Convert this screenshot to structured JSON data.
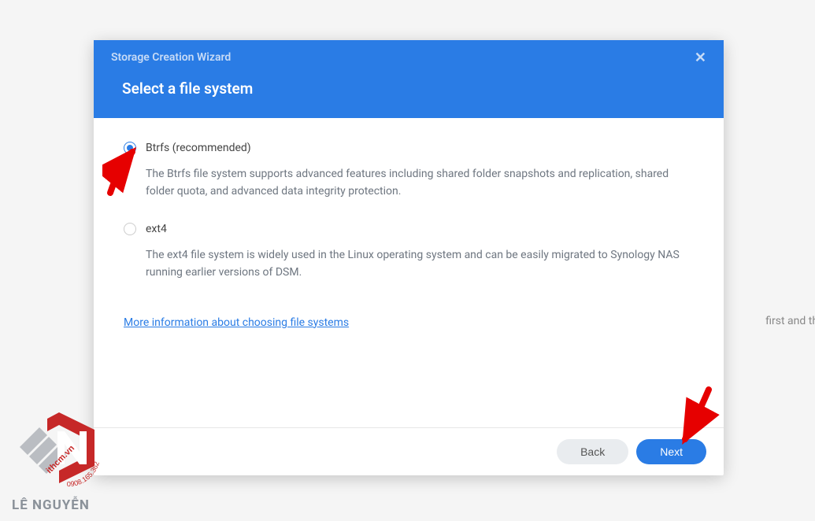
{
  "backgroundText": "first and then c",
  "modal": {
    "wizardName": "Storage Creation Wizard",
    "title": "Select a file system",
    "options": [
      {
        "label": "Btrfs (recommended)",
        "description": "The Btrfs file system supports advanced features including shared folder snapshots and replication, shared folder quota, and advanced data integrity protection.",
        "selected": true
      },
      {
        "label": "ext4",
        "description": "The ext4 file system is widely used in the Linux operating system and can be easily migrated to Synology NAS running earlier versions of DSM.",
        "selected": false
      }
    ],
    "infoLink": "More information about choosing file systems",
    "buttons": {
      "back": "Back",
      "next": "Next"
    }
  },
  "watermark": {
    "brand": "LÊ NGUYỄN",
    "domain": "ithcm.vn",
    "phone": "0908.165.362"
  }
}
